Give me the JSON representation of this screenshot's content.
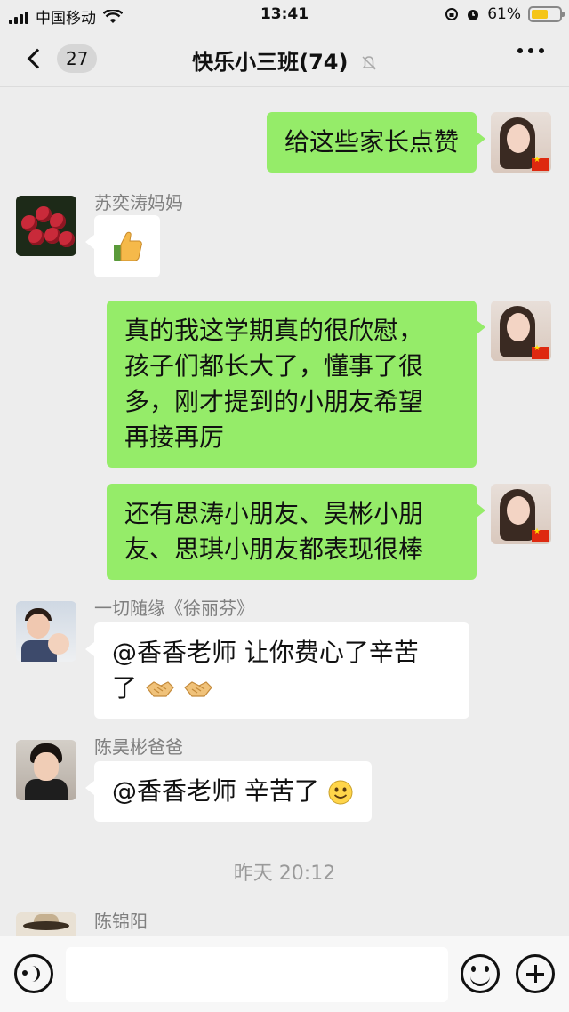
{
  "status_bar": {
    "carrier": "中国移动",
    "time": "13:41",
    "battery": "61%",
    "battery_level": 0.61
  },
  "nav": {
    "unread_count": "27",
    "title": "快乐小三班(74)",
    "icons": [
      "chevron-left-icon",
      "bell-muted-icon",
      "more-dots-icon"
    ]
  },
  "messages": [
    {
      "side": "right",
      "sender": "",
      "text": "给这些家长点赞",
      "avatar": "teacher"
    },
    {
      "side": "left",
      "sender": "苏奕涛妈妈",
      "text": "",
      "emoji": "thumbs-up",
      "avatar": "lychee"
    },
    {
      "side": "right",
      "sender": "",
      "lines": [
        "真的我这学期真的很欣慰，",
        "孩子们都长大了，懂事了很",
        "多，刚才提到的小朋友希望",
        "再接再厉"
      ],
      "avatar": "teacher"
    },
    {
      "side": "right",
      "sender": "",
      "lines": [
        "还有思涛小朋友、昊彬小朋",
        "友、思琪小朋友都表现很棒"
      ],
      "avatar": "teacher"
    },
    {
      "side": "left",
      "sender": "一切随缘《徐丽芬》",
      "lines": [
        "@香香老师 让你费心了辛苦",
        "了"
      ],
      "emoji": "handshake",
      "avatar": "couple"
    },
    {
      "side": "left",
      "sender": "陈昊彬爸爸",
      "text": "@香香老师 辛苦了",
      "emoji": "smile",
      "avatar": "boy"
    }
  ],
  "time_divider": "昨天 20:12",
  "last_sender": "陈锦阳",
  "input_bar": {
    "placeholder": "",
    "icons": [
      "voice-icon",
      "emoji-icon",
      "plus-icon"
    ]
  }
}
